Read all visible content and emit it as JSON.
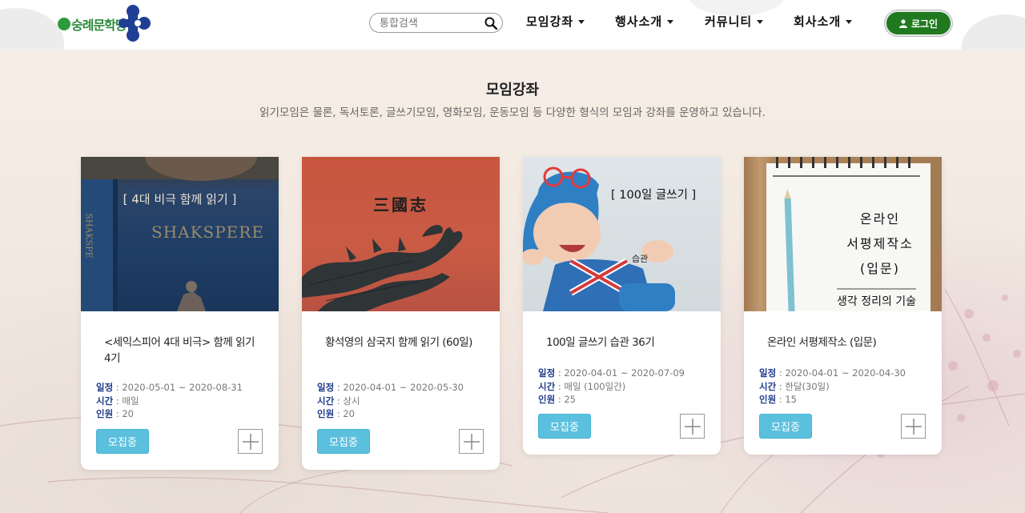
{
  "header": {
    "logo_text": "숭례문학당",
    "search": {
      "placeholder": "통합검색"
    },
    "nav": [
      {
        "label": "모임강좌"
      },
      {
        "label": "행사소개"
      },
      {
        "label": "커뮤니티"
      },
      {
        "label": "회사소개"
      }
    ],
    "login_label": "로그인"
  },
  "section": {
    "title": "모임강좌",
    "description": "읽기모임은 물론, 독서토론, 글쓰기모임, 영화모임, 운동모임 등 다양한 형식의 모임과 강좌를 운영하고 있습니다."
  },
  "meta_labels": {
    "schedule": "일정",
    "time": "시간",
    "people": "인원"
  },
  "cards": [
    {
      "image_caption": "[ 4대 비극 함께 읽기 ]",
      "image_subtext": "SHAKSPERE",
      "image_spine": "SHAKSPE",
      "title": "<세익스피어 4대 비극> 함께 읽기 4기",
      "schedule": "2020-05-01 ~ 2020-08-31",
      "time": "매일",
      "people": "20",
      "status": "모집중"
    },
    {
      "image_caption": "三國志",
      "title": "황석영의 삼국지 함께 읽기 (60일)",
      "schedule": "2020-04-01 ~ 2020-05-30",
      "time": "상시",
      "people": "20",
      "status": "모집중"
    },
    {
      "image_caption": "[ 100일 글쓰기 ]",
      "image_subtext": "습관",
      "title": "100일 글쓰기 습관 36기",
      "schedule": "2020-04-01 ~ 2020-07-09",
      "time": "매일 (100일간)",
      "people": "25",
      "status": "모집중"
    },
    {
      "image_caption_lines": [
        "온라인",
        "서평제작소",
        "(입문)"
      ],
      "image_subtext": "생각 정리의 기술",
      "title": "온라인 서평제작소 (입문)",
      "schedule": "2020-04-01 ~ 2020-04-30",
      "time": "한달(30일)",
      "people": "15",
      "status": "모집중"
    }
  ],
  "colors": {
    "accent_green": "#1f7a1f",
    "status_button": "#5bc0de",
    "meta_label": "#1e3c8c"
  }
}
